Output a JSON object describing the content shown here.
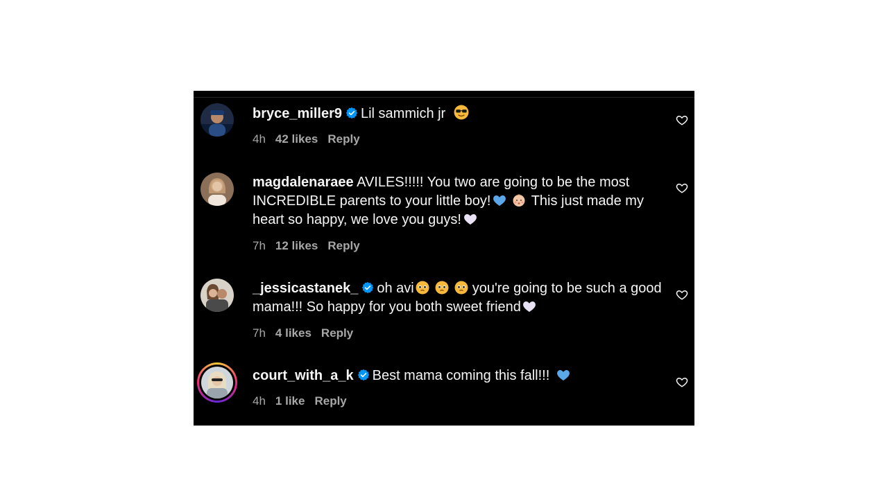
{
  "comments": [
    {
      "username": "bryce_miller9",
      "verified": true,
      "text": "Lil sammich jr",
      "emoji": [
        "sunglasses-face"
      ],
      "time": "4h",
      "likes": "42 likes",
      "reply": "Reply"
    },
    {
      "username": "magdalenaraee",
      "verified": false,
      "text_1": "AVILES!!!!! You two are going to be the most INCREDIBLE parents to your little boy!",
      "text_2": "This just made my heart so happy, we love you guys!",
      "emoji": [
        "blue-heart",
        "baby",
        "white-heart"
      ],
      "time": "7h",
      "likes": "12 likes",
      "reply": "Reply"
    },
    {
      "username": "_jessicastanek_",
      "verified": true,
      "text_1": "oh avi",
      "text_2": "you're going to be such a good mama!!! So happy for you both sweet friend",
      "emoji": [
        "pleading-face",
        "pleading-face",
        "pleading-face",
        "white-heart"
      ],
      "time": "7h",
      "likes": "4 likes",
      "reply": "Reply"
    },
    {
      "username": "court_with_a_k",
      "verified": true,
      "text": "Best mama coming this fall!!!",
      "emoji": [
        "blue-heart"
      ],
      "time": "4h",
      "likes": "1 like",
      "reply": "Reply"
    }
  ],
  "colors": {
    "background": "#000000",
    "text": "#f5f5f5",
    "meta": "#a8a8a8",
    "verified": "#0095f6"
  }
}
